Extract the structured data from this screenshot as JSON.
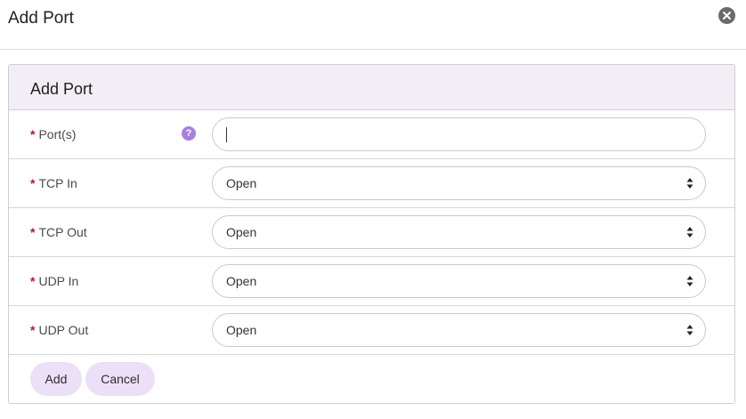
{
  "dialog": {
    "title": "Add Port",
    "close_icon": "close-icon"
  },
  "panel": {
    "title": "Add Port"
  },
  "required_marker": "*",
  "fields": {
    "ports": {
      "label": "Port(s)",
      "value": "",
      "placeholder": "",
      "help_glyph": "?",
      "help_icon": "question-icon"
    },
    "tcp_in": {
      "label": "TCP In",
      "value": "Open"
    },
    "tcp_out": {
      "label": "TCP Out",
      "value": "Open"
    },
    "udp_in": {
      "label": "UDP In",
      "value": "Open"
    },
    "udp_out": {
      "label": "UDP Out",
      "value": "Open"
    }
  },
  "buttons": {
    "add": "Add",
    "cancel": "Cancel"
  },
  "colors": {
    "panel_header_bg": "#f3eef6",
    "button_bg": "#ecdff8",
    "help_icon": "#a77fe0",
    "required_star": "#c0142c",
    "close_icon": "#6b6b6b"
  }
}
